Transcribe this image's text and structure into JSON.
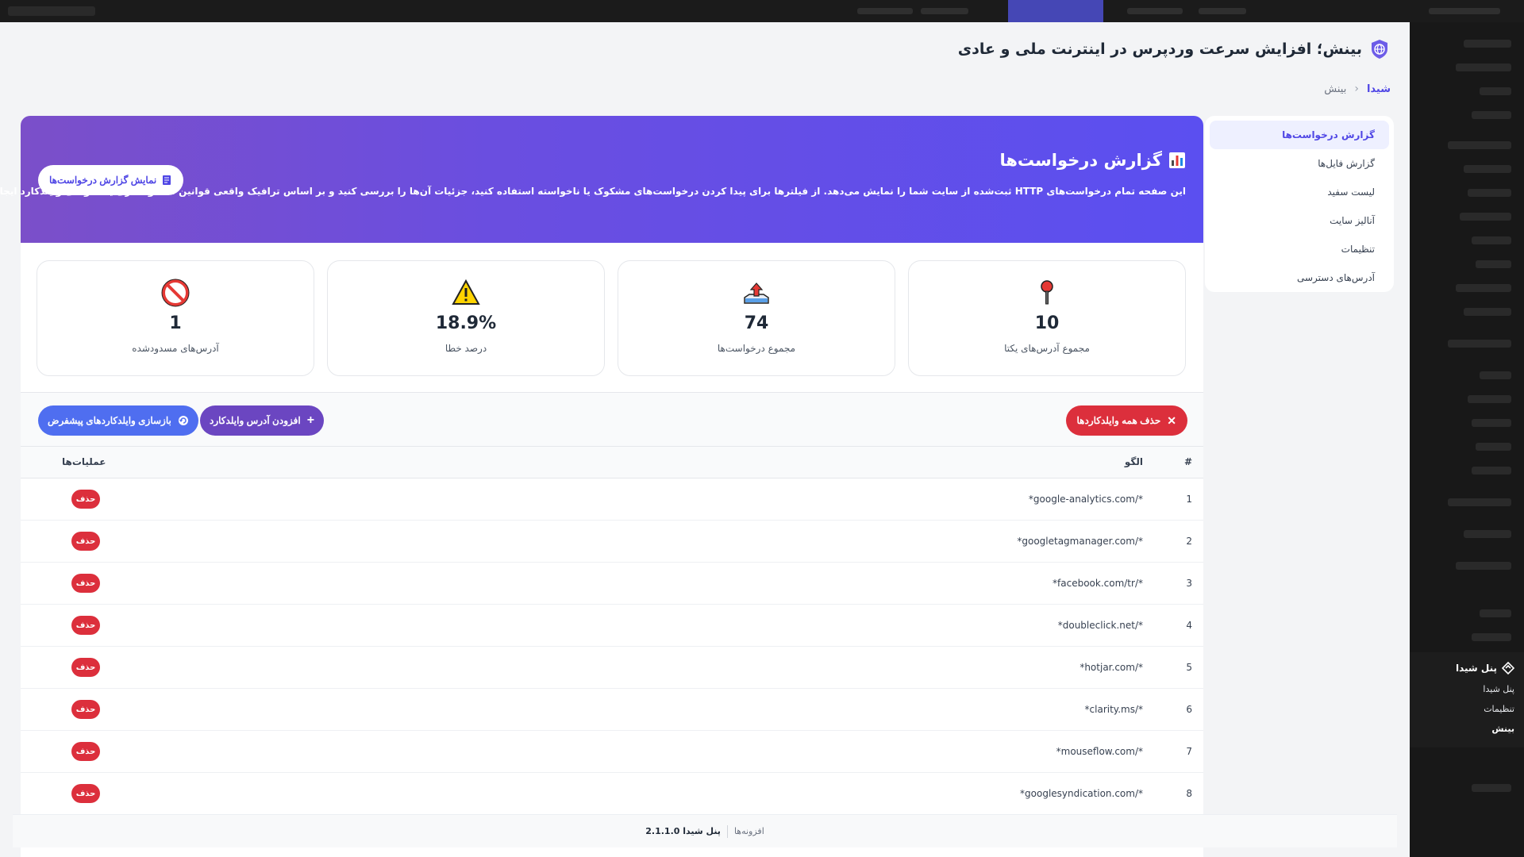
{
  "page": {
    "title": "بینش؛ افزایش سرعت وردپرس در اینترنت ملی و عادی"
  },
  "breadcrumb": {
    "root": "شیدا",
    "separator": "‹",
    "current": "بینش"
  },
  "sidebar": {
    "items": [
      {
        "label": "گزارش درخواست‌ها",
        "active": true
      },
      {
        "label": "گزارش فایل‌ها"
      },
      {
        "label": "لیست سفید"
      },
      {
        "label": "آنالیز سایت"
      },
      {
        "label": "تنظیمات"
      },
      {
        "label": "آدرس‌های دسترسی"
      }
    ]
  },
  "hero": {
    "title": "گزارش درخواست‌ها",
    "description": "این صفحه تمام درخواست‌های HTTP ثبت‌شده از سایت شما را نمایش می‌دهد. از فیلترها برای پیدا کردن درخواست‌های مشکوک یا ناخواسته استفاده کنید، جزئیات آن‌ها را بررسی کنید و بر اساس ترافیک واقعی قوانین مسدودسازی یا الگوهای وایلدکارد ایجاد کنید.",
    "button_label": "نمایش گزارش درخواست‌ها",
    "gradient_start": "#7b4fc9",
    "gradient_end": "#5b4ff0"
  },
  "stats": [
    {
      "icon": "pin-icon",
      "value": "10",
      "label": "مجموع آدرس‌های یکتا"
    },
    {
      "icon": "upload-tray-icon",
      "value": "74",
      "label": "مجموع درخواست‌ها"
    },
    {
      "icon": "warning-icon",
      "value": "18.9%",
      "label": "درصد خطا"
    },
    {
      "icon": "prohibited-icon",
      "value": "1",
      "label": "آدرس‌های مسدودشده"
    }
  ],
  "actions": {
    "delete_all_label": "حذف همه وایلدکاردها",
    "add_label": "افزودن آدرس وایلدکارد",
    "reset_label": "بازسازی وایلدکاردهای پیشفرض"
  },
  "table": {
    "headers": {
      "num": "#",
      "pattern": "الگو",
      "ops": "عملیات‌ها"
    },
    "delete_label": "حذف",
    "rows": [
      {
        "num": "1",
        "pattern": "*google-analytics.com/*"
      },
      {
        "num": "2",
        "pattern": "*googletagmanager.com/*"
      },
      {
        "num": "3",
        "pattern": "*facebook.com/tr/*"
      },
      {
        "num": "4",
        "pattern": "*doubleclick.net/*"
      },
      {
        "num": "5",
        "pattern": "*hotjar.com/*"
      },
      {
        "num": "6",
        "pattern": "*clarity.ms/*"
      },
      {
        "num": "7",
        "pattern": "*mouseflow.com/*"
      },
      {
        "num": "8",
        "pattern": "*googlesyndication.com/*"
      }
    ]
  },
  "footer": {
    "plugins": "افزونه‌ها",
    "version": "پنل شیدا 2.1.1.0"
  },
  "admin_menu": {
    "head": "پنل شیدا",
    "items": [
      "پنل شیدا",
      "تنظیمات",
      "بینش"
    ]
  },
  "colors": {
    "accent": "#4f46e5",
    "danger": "#dc2f3c",
    "purple": "#6b46c1",
    "blue": "#4f6ef0"
  }
}
